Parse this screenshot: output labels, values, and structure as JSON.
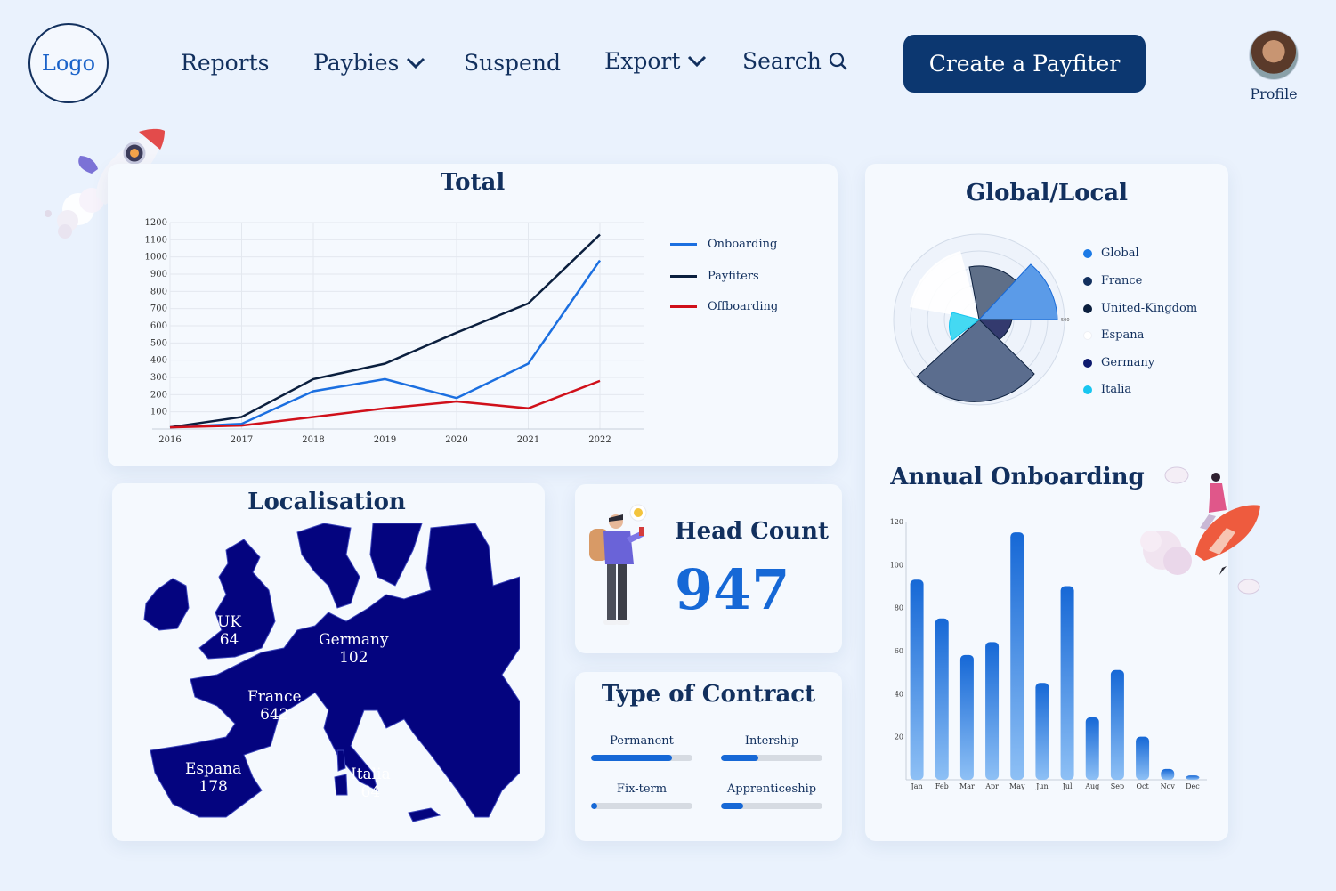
{
  "header": {
    "logo": "Logo",
    "nav": [
      {
        "label": "Reports",
        "dropdown": false
      },
      {
        "label": "Paybies",
        "dropdown": true
      },
      {
        "label": "Suspend",
        "dropdown": false
      },
      {
        "label": "Export",
        "dropdown": true
      },
      {
        "label": "Search",
        "icon": "search-icon"
      }
    ],
    "cta": "Create a Payfiter",
    "profile_label": "Profile"
  },
  "colors": {
    "accent": "#1668d6",
    "navy": "#0c3770",
    "red": "#d0101a",
    "dark_line": "#0b1f3e"
  },
  "total_card": {
    "title": "Total",
    "chart_data": {
      "type": "line",
      "x": [
        2016,
        2017,
        2018,
        2019,
        2020,
        2021,
        2022
      ],
      "y_ticks": [
        100,
        200,
        300,
        400,
        500,
        600,
        700,
        800,
        900,
        1000,
        1100,
        1200
      ],
      "ylim": [
        0,
        1200
      ],
      "series": [
        {
          "name": "Onboarding",
          "color": "#1b6fe0",
          "values": [
            10,
            30,
            220,
            290,
            180,
            380,
            980
          ]
        },
        {
          "name": "Payfiters",
          "color": "#0b1f3e",
          "values": [
            10,
            70,
            290,
            380,
            560,
            730,
            1130
          ]
        },
        {
          "name": "Offboarding",
          "color": "#d0101a",
          "values": [
            10,
            20,
            70,
            120,
            160,
            120,
            280
          ]
        }
      ]
    }
  },
  "global_card": {
    "title": "Global/Local",
    "radial_tick": "500",
    "chart_data": {
      "type": "pie",
      "subtype": "polar-area",
      "series": [
        {
          "name": "Global",
          "color": "#1b7ae6"
        },
        {
          "name": "France",
          "color": "#12305e"
        },
        {
          "name": "United-Kingdom",
          "color": "#0b1f3e"
        },
        {
          "name": "Espana",
          "color": "#ffffff"
        },
        {
          "name": "Germany",
          "color": "#0d1a6e"
        },
        {
          "name": "Italia",
          "color": "#18c6f0"
        }
      ]
    }
  },
  "localisation_card": {
    "title": "Localisation",
    "regions": [
      {
        "name": "UK",
        "value": "64"
      },
      {
        "name": "Germany",
        "value": "102"
      },
      {
        "name": "France",
        "value": "642"
      },
      {
        "name": "Espana",
        "value": "178"
      },
      {
        "name": "Italia",
        "value": "64"
      }
    ]
  },
  "headcount_card": {
    "label": "Head Count",
    "value": "947"
  },
  "contract_card": {
    "title": "Type of Contract",
    "items": [
      {
        "label": "Permanent",
        "fraction": 0.8
      },
      {
        "label": "Intership",
        "fraction": 0.37
      },
      {
        "label": "Fix-term",
        "fraction": 0.06
      },
      {
        "label": "Apprenticeship",
        "fraction": 0.22
      }
    ]
  },
  "annual_card": {
    "title": "Annual Onboarding",
    "chart_data": {
      "type": "bar",
      "categories": [
        "Jan",
        "Feb",
        "Mar",
        "Apr",
        "May",
        "Jun",
        "Jul",
        "Aug",
        "Sep",
        "Oct",
        "Nov",
        "Dec"
      ],
      "values": [
        93,
        75,
        58,
        64,
        115,
        45,
        90,
        29,
        51,
        20,
        5,
        2
      ],
      "y_ticks": [
        20,
        40,
        60,
        80,
        100,
        120
      ],
      "ylim": [
        0,
        120
      ]
    }
  }
}
